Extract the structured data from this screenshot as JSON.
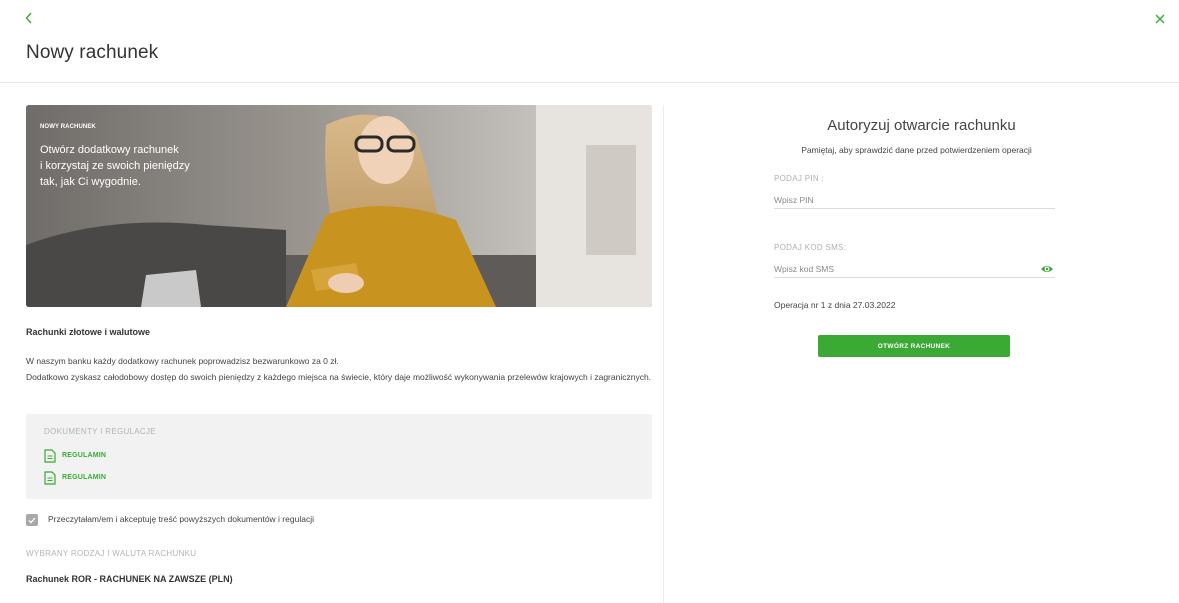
{
  "header": {
    "back_icon": "chevron-left-icon",
    "close_icon": "close-icon",
    "title": "Nowy rachunek"
  },
  "hero": {
    "tag": "NOWY RACHUNEK",
    "text": "Otwórz dodatkowy rachunek\ni korzystaj ze swoich pieniędzy\ntak, jak Ci wygodnie."
  },
  "info": {
    "heading": "Rachunki złotowe i walutowe",
    "line1": "W naszym banku każdy dodatkowy rachunek poprowadzisz bezwarunkowo za 0 zł.",
    "line2": "Dodatkowo zyskasz całodobowy dostęp do swoich pieniędzy z każdego miejsca na świecie, który daje możliwość wykonywania przelewów krajowych i zagranicznych."
  },
  "documents": {
    "title": "DOKUMENTY I REGULACJE",
    "items": [
      {
        "label": "REGULAMIN",
        "icon": "document-icon"
      },
      {
        "label": "REGULAMIN",
        "icon": "document-icon"
      }
    ]
  },
  "consent": {
    "label": "Przeczytałam/em i akceptuję treść powyższych dokumentów i regulacji",
    "checked": true
  },
  "account_type": {
    "label": "WYBRANY RODZAJ I WALUTA RACHUNKU",
    "value": "Rachunek ROR - RACHUNEK NA ZAWSZE (PLN)"
  },
  "auth": {
    "title": "Autoryzuj otwarcie rachunku",
    "subtitle": "Pamiętaj, aby sprawdzić dane przed potwierdzeniem operacji",
    "pin_label": "PODAJ PIN :",
    "pin_placeholder": "Wpisz PIN",
    "sms_label": "PODAJ KOD SMS:",
    "sms_placeholder": "Wpisz kod SMS",
    "eye_icon": "eye-icon",
    "operation": "Operacja nr 1  z dnia 27.03.2022",
    "button": "OTWÓRZ RACHUNEK"
  },
  "colors": {
    "accent": "#3aaa35",
    "muted_label": "#b4b4b4",
    "panel_bg": "#f2f2f2"
  }
}
